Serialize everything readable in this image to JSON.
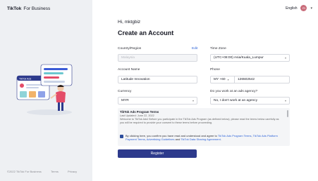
{
  "brand": {
    "name": "TikTok",
    "sub": "For Business"
  },
  "header": {
    "language": "English",
    "avatar_initials": "m"
  },
  "greeting": "Hi, mktgbiz",
  "title": "Create an Account",
  "form": {
    "country": {
      "label": "Country/Region",
      "value": "Malaysia",
      "edit_label": "Edit"
    },
    "timezone": {
      "label": "Time Zone",
      "value": "(UTC+08:00) Asia/Kuala_Lumpur"
    },
    "account_name": {
      "label": "Account Name",
      "value": "Latitude Innovation"
    },
    "phone": {
      "label": "Phone",
      "code": "MY +60",
      "number": "126502542"
    },
    "currency": {
      "label": "Currency",
      "value": "MYR"
    },
    "agency": {
      "label": "Do you work at an ads agency?",
      "value": "No, I don't work at an agency"
    }
  },
  "terms": {
    "title": "TikTok Ads Program Terms",
    "updated": "Last Updated: June 22, 2022",
    "body": "Welcome to TikTok Ads! Before you participate in the TikTok Ads Program (as defined below), please read the terms below carefully as you will be required to provide your consent to these terms before proceeding."
  },
  "agree": {
    "text": "By clicking here, you confirm you have read and understood and agree to ",
    "link1": "TikTok Ads Program Terms",
    "sep1": ", ",
    "link2": "TikTok Ads Platform Payment Terms",
    "sep2": ", ",
    "link3": "Advertising Guidelines",
    "sep3": " and ",
    "link4": "TikTok Data Sharing Agreement",
    "end": "."
  },
  "register_label": "Register",
  "footer": {
    "copyright": "©2022 TikTok For Business",
    "terms": "Terms",
    "privacy": "Privacy"
  },
  "illustration_label": "TikTok Ads",
  "colors": {
    "primary": "#2d3a8c",
    "link": "#2c62d8",
    "sidebar": "#eef0f3"
  }
}
